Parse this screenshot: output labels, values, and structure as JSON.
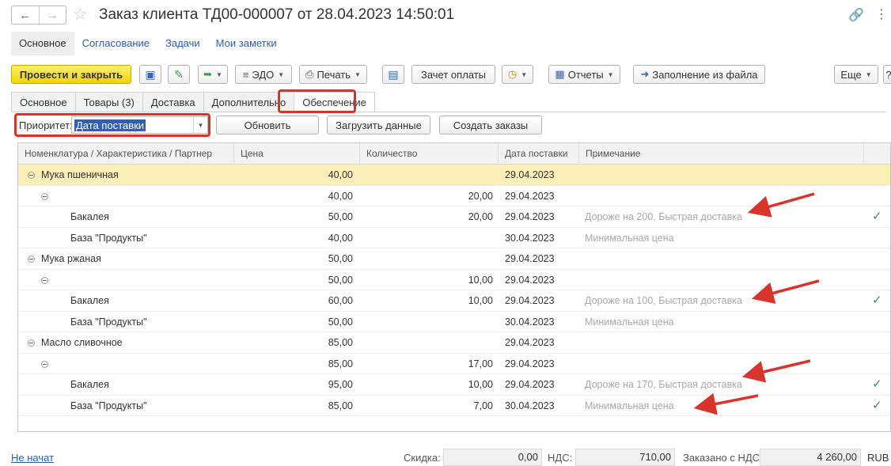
{
  "window": {
    "title": "Заказ клиента ТД00-000007 от 28.04.2023 14:50:01",
    "back_icon": "arrow-left-icon",
    "forward_icon": "arrow-right-icon",
    "favorite_icon": "star-icon",
    "link_icon": "link-icon",
    "more_icon": "more-vertical-icon"
  },
  "sections": [
    "Основное",
    "Согласование",
    "Задачи",
    "Мои заметки"
  ],
  "toolbar": {
    "post_close": "Провести и закрыть",
    "edo": "ЭДО",
    "print": "Печать",
    "offset": "Зачет оплаты",
    "reports": "Отчеты",
    "fill_file": "Заполнение из файла",
    "more": "Еще",
    "help": "?"
  },
  "tabs": [
    "Основное",
    "Товары (3)",
    "Доставка",
    "Дополнительно",
    "Обеспечение"
  ],
  "priority": {
    "label": "Приоритет:",
    "value": "Дата поставки",
    "refresh": "Обновить",
    "load": "Загрузить данные",
    "create": "Создать заказы"
  },
  "table": {
    "headers": [
      "Номенклатура / Характеристика / Партнер",
      "Цена",
      "Количество",
      "Дата поставки",
      "Примечание"
    ],
    "rows": [
      {
        "level": 0,
        "name": "Мука пшеничная",
        "price": "40,00",
        "qty": "",
        "date": "29.04.2023",
        "note": "",
        "check": false
      },
      {
        "level": 1,
        "name": "",
        "price": "40,00",
        "qty": "20,00",
        "date": "29.04.2023",
        "note": "",
        "check": false
      },
      {
        "level": 2,
        "name": "Бакалея",
        "price": "50,00",
        "qty": "20,00",
        "date": "29.04.2023",
        "note": "Дороже на 200, Быстрая доставка",
        "check": true
      },
      {
        "level": 2,
        "name": "База \"Продукты\"",
        "price": "40,00",
        "qty": "",
        "date": "30.04.2023",
        "note": "Минимальная цена",
        "check": false
      },
      {
        "level": 0,
        "name": "Мука ржаная",
        "price": "50,00",
        "qty": "",
        "date": "29.04.2023",
        "note": "",
        "check": false
      },
      {
        "level": 1,
        "name": "",
        "price": "50,00",
        "qty": "10,00",
        "date": "29.04.2023",
        "note": "",
        "check": false
      },
      {
        "level": 2,
        "name": "Бакалея",
        "price": "60,00",
        "qty": "10,00",
        "date": "29.04.2023",
        "note": "Дороже на 100, Быстрая доставка",
        "check": true
      },
      {
        "level": 2,
        "name": "База \"Продукты\"",
        "price": "50,00",
        "qty": "",
        "date": "30.04.2023",
        "note": "Минимальная цена",
        "check": false
      },
      {
        "level": 0,
        "name": "Масло сливочное",
        "price": "85,00",
        "qty": "",
        "date": "29.04.2023",
        "note": "",
        "check": false
      },
      {
        "level": 1,
        "name": "",
        "price": "85,00",
        "qty": "17,00",
        "date": "29.04.2023",
        "note": "",
        "check": false
      },
      {
        "level": 2,
        "name": "Бакалея",
        "price": "95,00",
        "qty": "10,00",
        "date": "29.04.2023",
        "note": "Дороже на 170, Быстрая доставка",
        "check": true
      },
      {
        "level": 2,
        "name": "База \"Продукты\"",
        "price": "85,00",
        "qty": "7,00",
        "date": "30.04.2023",
        "note": "Минимальная цена",
        "check": true
      }
    ]
  },
  "footer": {
    "link": "Не начат",
    "discount_label": "Скидка:",
    "discount": "0,00",
    "vat_label": "НДС:",
    "vat": "710,00",
    "ordered_label": "Заказано с НДС:",
    "ordered": "4 260,00",
    "currency": "RUB"
  },
  "colors": {
    "highlight": "#d9342b",
    "primary_button": "#f3d300",
    "selected_row": "#fbeeb7",
    "link": "#2a5ea8",
    "check": "#2e9a3a"
  }
}
